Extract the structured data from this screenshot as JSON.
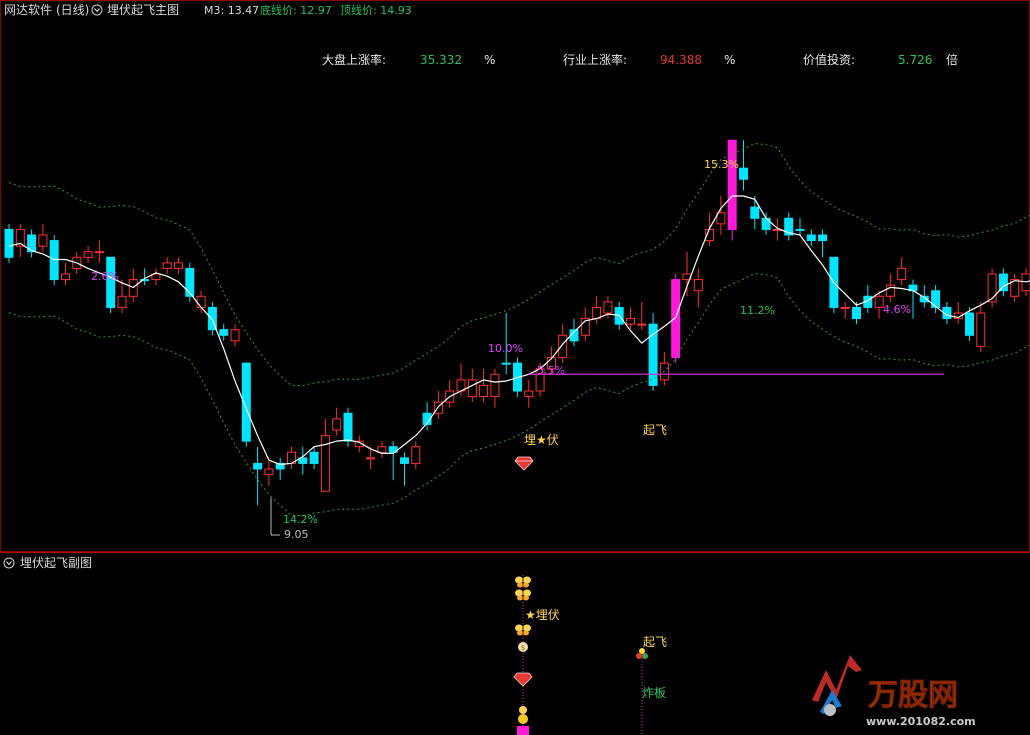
{
  "main_panel": {
    "software_name": "网达软件",
    "period": "(日线)",
    "indicator_name": "埋伏起飞主图",
    "m3_label": "M3: 13.47",
    "bottom_price_label": "底线价: 12.97",
    "top_price_label": "顶线价: 14.93"
  },
  "stats": {
    "market_label": "大盘上涨率:",
    "market_value": "35.332",
    "market_unit": "%",
    "industry_label": "行业上涨率:",
    "industry_value": "94.388",
    "industry_unit": "%",
    "value_label": "价值投资:",
    "value_value": "5.726",
    "value_unit": "倍"
  },
  "annotations": {
    "pct_2_6": "2.6%",
    "pct_14_2": "14.2%",
    "low_price": "9.05",
    "pct_10_0": "10.0%",
    "pct_5_5": "5.5%",
    "ambush": "埋★伏",
    "takeoff": "起飞",
    "pct_15_3": "15.3%",
    "pct_11_2": "11.2%",
    "pct_4_6": "4.6%"
  },
  "sub_panel": {
    "indicator_name": "埋伏起飞副图",
    "ambush_label": "★埋伏",
    "takeoff_label": "起飞",
    "limit_break_label": "炸板"
  },
  "watermark": {
    "brand": "万股网",
    "url": "www.201082.com"
  },
  "chart_data": {
    "type": "candlestick",
    "price_range": [
      9,
      16
    ],
    "candles": [
      {
        "o": 14.0,
        "c": 13.5,
        "h": 14.1,
        "l": 13.4,
        "type": "down"
      },
      {
        "o": 13.7,
        "c": 14.0,
        "h": 14.1,
        "l": 13.5,
        "type": "up"
      },
      {
        "o": 13.9,
        "c": 13.6,
        "h": 14.0,
        "l": 13.5,
        "type": "down"
      },
      {
        "o": 13.7,
        "c": 13.9,
        "h": 14.1,
        "l": 13.6,
        "type": "up"
      },
      {
        "o": 13.8,
        "c": 13.1,
        "h": 13.9,
        "l": 13.0,
        "type": "down"
      },
      {
        "o": 13.1,
        "c": 13.2,
        "h": 13.4,
        "l": 13.0,
        "type": "up"
      },
      {
        "o": 13.3,
        "c": 13.5,
        "h": 13.6,
        "l": 13.2,
        "type": "up"
      },
      {
        "o": 13.5,
        "c": 13.6,
        "h": 13.7,
        "l": 13.4,
        "type": "up"
      },
      {
        "o": 13.6,
        "c": 13.6,
        "h": 13.8,
        "l": 13.4,
        "type": "up"
      },
      {
        "o": 13.5,
        "c": 12.6,
        "h": 13.5,
        "l": 12.5,
        "type": "down"
      },
      {
        "o": 12.6,
        "c": 12.8,
        "h": 13.1,
        "l": 12.5,
        "type": "up"
      },
      {
        "o": 12.8,
        "c": 13.1,
        "h": 13.3,
        "l": 12.7,
        "type": "up"
      },
      {
        "o": 13.1,
        "c": 13.1,
        "h": 13.3,
        "l": 13.0,
        "type": "down"
      },
      {
        "o": 13.1,
        "c": 13.2,
        "h": 13.3,
        "l": 13.0,
        "type": "up"
      },
      {
        "o": 13.3,
        "c": 13.4,
        "h": 13.5,
        "l": 13.2,
        "type": "up"
      },
      {
        "o": 13.4,
        "c": 13.3,
        "h": 13.5,
        "l": 13.2,
        "type": "up"
      },
      {
        "o": 13.3,
        "c": 12.8,
        "h": 13.4,
        "l": 12.7,
        "type": "down"
      },
      {
        "o": 12.8,
        "c": 12.6,
        "h": 12.9,
        "l": 12.5,
        "type": "up"
      },
      {
        "o": 12.6,
        "c": 12.2,
        "h": 12.7,
        "l": 12.1,
        "type": "down"
      },
      {
        "o": 12.2,
        "c": 12.1,
        "h": 12.3,
        "l": 12.0,
        "type": "down"
      },
      {
        "o": 12.0,
        "c": 12.2,
        "h": 12.3,
        "l": 11.9,
        "type": "up"
      },
      {
        "o": 11.6,
        "c": 10.2,
        "h": 11.6,
        "l": 10.1,
        "type": "down"
      },
      {
        "o": 9.8,
        "c": 9.7,
        "h": 10.1,
        "l": 9.05,
        "type": "down"
      },
      {
        "o": 9.6,
        "c": 9.7,
        "h": 9.9,
        "l": 9.4,
        "type": "up"
      },
      {
        "o": 9.8,
        "c": 9.7,
        "h": 9.9,
        "l": 9.5,
        "type": "down"
      },
      {
        "o": 9.8,
        "c": 10.0,
        "h": 10.1,
        "l": 9.7,
        "type": "up"
      },
      {
        "o": 9.9,
        "c": 9.8,
        "h": 10.1,
        "l": 9.6,
        "type": "down"
      },
      {
        "o": 10.0,
        "c": 9.8,
        "h": 10.1,
        "l": 9.7,
        "type": "down"
      },
      {
        "o": 9.3,
        "c": 10.3,
        "h": 10.6,
        "l": 9.3,
        "type": "up"
      },
      {
        "o": 10.4,
        "c": 10.6,
        "h": 10.8,
        "l": 10.3,
        "type": "up"
      },
      {
        "o": 10.7,
        "c": 10.2,
        "h": 10.8,
        "l": 10.1,
        "type": "down"
      },
      {
        "o": 10.2,
        "c": 10.1,
        "h": 10.3,
        "l": 10.0,
        "type": "up"
      },
      {
        "o": 9.9,
        "c": 9.9,
        "h": 10.1,
        "l": 9.7,
        "type": "up"
      },
      {
        "o": 10.0,
        "c": 10.1,
        "h": 10.2,
        "l": 9.9,
        "type": "up"
      },
      {
        "o": 10.1,
        "c": 10.0,
        "h": 10.2,
        "l": 9.5,
        "type": "down"
      },
      {
        "o": 9.9,
        "c": 9.8,
        "h": 10.0,
        "l": 9.4,
        "type": "down"
      },
      {
        "o": 9.8,
        "c": 10.1,
        "h": 10.2,
        "l": 9.7,
        "type": "up"
      },
      {
        "o": 10.5,
        "c": 10.7,
        "h": 10.9,
        "l": 10.4,
        "type": "down"
      },
      {
        "o": 10.7,
        "c": 10.9,
        "h": 11.1,
        "l": 10.6,
        "type": "up"
      },
      {
        "o": 10.9,
        "c": 11.1,
        "h": 11.3,
        "l": 10.8,
        "type": "up"
      },
      {
        "o": 11.1,
        "c": 11.3,
        "h": 11.6,
        "l": 11.0,
        "type": "up"
      },
      {
        "o": 11.3,
        "c": 11.0,
        "h": 11.5,
        "l": 10.9,
        "type": "up"
      },
      {
        "o": 11.0,
        "c": 11.2,
        "h": 11.5,
        "l": 10.9,
        "type": "up"
      },
      {
        "o": 11.0,
        "c": 11.4,
        "h": 11.5,
        "l": 10.8,
        "type": "up"
      },
      {
        "o": 11.6,
        "c": 11.6,
        "h": 12.5,
        "l": 11.4,
        "type": "down"
      },
      {
        "o": 11.6,
        "c": 11.1,
        "h": 11.7,
        "l": 11.0,
        "type": "down"
      },
      {
        "o": 11.0,
        "c": 11.1,
        "h": 11.3,
        "l": 10.8,
        "type": "up"
      },
      {
        "o": 11.1,
        "c": 11.5,
        "h": 11.6,
        "l": 11.0,
        "type": "up"
      },
      {
        "o": 11.5,
        "c": 11.7,
        "h": 11.9,
        "l": 11.4,
        "type": "up"
      },
      {
        "o": 11.7,
        "c": 12.1,
        "h": 12.3,
        "l": 11.6,
        "type": "up"
      },
      {
        "o": 12.2,
        "c": 12.0,
        "h": 12.4,
        "l": 11.9,
        "type": "down"
      },
      {
        "o": 12.1,
        "c": 12.4,
        "h": 12.6,
        "l": 12.0,
        "type": "up"
      },
      {
        "o": 12.4,
        "c": 12.6,
        "h": 12.8,
        "l": 12.3,
        "type": "up"
      },
      {
        "o": 12.5,
        "c": 12.7,
        "h": 12.8,
        "l": 12.4,
        "type": "up"
      },
      {
        "o": 12.6,
        "c": 12.3,
        "h": 12.7,
        "l": 12.2,
        "type": "down"
      },
      {
        "o": 12.3,
        "c": 12.4,
        "h": 12.6,
        "l": 12.2,
        "type": "up"
      },
      {
        "o": 12.3,
        "c": 12.3,
        "h": 12.7,
        "l": 12.2,
        "type": "up"
      },
      {
        "o": 12.3,
        "c": 11.2,
        "h": 12.5,
        "l": 11.1,
        "type": "down"
      },
      {
        "o": 11.3,
        "c": 11.6,
        "h": 11.8,
        "l": 11.2,
        "type": "up"
      },
      {
        "o": 11.7,
        "c": 13.1,
        "h": 13.2,
        "l": 11.6,
        "type": "limit"
      },
      {
        "o": 13.2,
        "c": 13.1,
        "h": 13.6,
        "l": 12.8,
        "type": "up"
      },
      {
        "o": 12.9,
        "c": 13.1,
        "h": 13.3,
        "l": 12.6,
        "type": "up"
      },
      {
        "o": 13.8,
        "c": 14.0,
        "h": 14.3,
        "l": 13.7,
        "type": "up"
      },
      {
        "o": 14.1,
        "c": 14.3,
        "h": 14.6,
        "l": 13.9,
        "type": "up"
      },
      {
        "o": 14.0,
        "c": 15.6,
        "h": 15.6,
        "l": 13.8,
        "type": "limit"
      },
      {
        "o": 15.1,
        "c": 14.9,
        "h": 15.6,
        "l": 14.7,
        "type": "down"
      },
      {
        "o": 14.4,
        "c": 14.2,
        "h": 14.6,
        "l": 14.0,
        "type": "down"
      },
      {
        "o": 14.2,
        "c": 14.0,
        "h": 14.3,
        "l": 13.9,
        "type": "down"
      },
      {
        "o": 14.0,
        "c": 14.0,
        "h": 14.2,
        "l": 13.8,
        "type": "up"
      },
      {
        "o": 14.2,
        "c": 13.9,
        "h": 14.3,
        "l": 13.8,
        "type": "down"
      },
      {
        "o": 14.0,
        "c": 14.0,
        "h": 14.2,
        "l": 13.9,
        "type": "down"
      },
      {
        "o": 13.9,
        "c": 13.8,
        "h": 14.0,
        "l": 13.7,
        "type": "down"
      },
      {
        "o": 13.9,
        "c": 13.8,
        "h": 14.0,
        "l": 13.5,
        "type": "down"
      },
      {
        "o": 13.5,
        "c": 12.6,
        "h": 13.5,
        "l": 12.5,
        "type": "down"
      },
      {
        "o": 12.6,
        "c": 12.6,
        "h": 12.7,
        "l": 12.4,
        "type": "up"
      },
      {
        "o": 12.6,
        "c": 12.4,
        "h": 12.7,
        "l": 12.3,
        "type": "down"
      },
      {
        "o": 12.6,
        "c": 12.8,
        "h": 13.0,
        "l": 12.5,
        "type": "down"
      },
      {
        "o": 12.6,
        "c": 12.8,
        "h": 12.9,
        "l": 12.4,
        "type": "up"
      },
      {
        "o": 12.8,
        "c": 13.0,
        "h": 13.2,
        "l": 12.7,
        "type": "up"
      },
      {
        "o": 13.1,
        "c": 13.3,
        "h": 13.5,
        "l": 13.0,
        "type": "up"
      },
      {
        "o": 13.0,
        "c": 12.9,
        "h": 13.1,
        "l": 12.4,
        "type": "down"
      },
      {
        "o": 12.8,
        "c": 12.7,
        "h": 13.0,
        "l": 12.6,
        "type": "down"
      },
      {
        "o": 12.9,
        "c": 12.6,
        "h": 13.0,
        "l": 12.5,
        "type": "down"
      },
      {
        "o": 12.6,
        "c": 12.4,
        "h": 12.7,
        "l": 12.3,
        "type": "down"
      },
      {
        "o": 12.4,
        "c": 12.5,
        "h": 12.7,
        "l": 12.3,
        "type": "up"
      },
      {
        "o": 12.5,
        "c": 12.1,
        "h": 12.6,
        "l": 12.0,
        "type": "down"
      },
      {
        "o": 11.9,
        "c": 12.5,
        "h": 12.7,
        "l": 11.8,
        "type": "up"
      },
      {
        "o": 12.7,
        "c": 13.2,
        "h": 13.3,
        "l": 12.6,
        "type": "up"
      },
      {
        "o": 13.2,
        "c": 12.9,
        "h": 13.3,
        "l": 12.8,
        "type": "down"
      },
      {
        "o": 12.8,
        "c": 13.1,
        "h": 13.2,
        "l": 12.7,
        "type": "up"
      },
      {
        "o": 12.9,
        "c": 13.2,
        "h": 13.3,
        "l": 12.8,
        "type": "up"
      },
      {
        "o": 13.4,
        "c": 13.0,
        "h": 13.6,
        "l": 12.9,
        "type": "up"
      },
      {
        "o": 13.6,
        "c": 13.1,
        "h": 13.8,
        "l": 13.0,
        "type": "down"
      }
    ],
    "support_price": 11.4
  }
}
